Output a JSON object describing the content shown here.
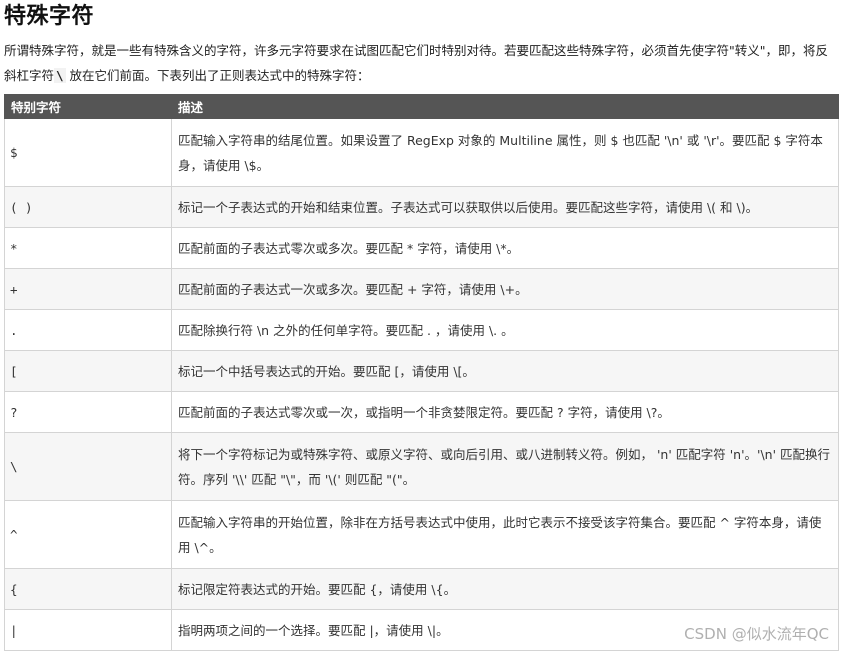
{
  "page": {
    "title": "特殊字符",
    "intro_part1": "所谓特殊字符，就是一些有特殊含义的字符，许多元字符要求在试图匹配它们时特别对待。若要匹配这些特殊字符，必须首先使字符\"转义\"，即，将反斜杠字符",
    "intro_code": "\\",
    "intro_part2": " 放在它们前面。下表列出了正则表达式中的特殊字符："
  },
  "table": {
    "headers": [
      "特别字符",
      "描述"
    ],
    "rows": [
      {
        "symbol": "$",
        "description": "匹配输入字符串的结尾位置。如果设置了 RegExp 对象的 Multiline 属性，则 $ 也匹配 '\\n' 或 '\\r'。要匹配 $ 字符本身，请使用 \\$。"
      },
      {
        "symbol": "( )",
        "description": "标记一个子表达式的开始和结束位置。子表达式可以获取供以后使用。要匹配这些字符，请使用 \\( 和 \\)。"
      },
      {
        "symbol": "*",
        "description": "匹配前面的子表达式零次或多次。要匹配 * 字符，请使用 \\*。"
      },
      {
        "symbol": "+",
        "description": "匹配前面的子表达式一次或多次。要匹配 + 字符，请使用 \\+。"
      },
      {
        "symbol": ".",
        "description": "匹配除换行符 \\n 之外的任何单字符。要匹配 . ，请使用 \\. 。"
      },
      {
        "symbol": "[",
        "description": "标记一个中括号表达式的开始。要匹配 [，请使用 \\[。"
      },
      {
        "symbol": "?",
        "description": "匹配前面的子表达式零次或一次，或指明一个非贪婪限定符。要匹配 ? 字符，请使用 \\?。"
      },
      {
        "symbol": "\\",
        "description": "将下一个字符标记为或特殊字符、或原义字符、或向后引用、或八进制转义符。例如， 'n' 匹配字符 'n'。'\\n' 匹配换行符。序列 '\\\\' 匹配 \"\\\"，而 '\\(' 则匹配 \"(\"。"
      },
      {
        "symbol": "^",
        "description": "匹配输入字符串的开始位置，除非在方括号表达式中使用，此时它表示不接受该字符集合。要匹配 ^ 字符本身，请使用 \\^。"
      },
      {
        "symbol": "{",
        "description": "标记限定符表达式的开始。要匹配 {，请使用 \\{。"
      },
      {
        "symbol": "|",
        "description": "指明两项之间的一个选择。要匹配 |，请使用 \\|。"
      }
    ]
  },
  "watermark": "CSDN @似水流年QC"
}
